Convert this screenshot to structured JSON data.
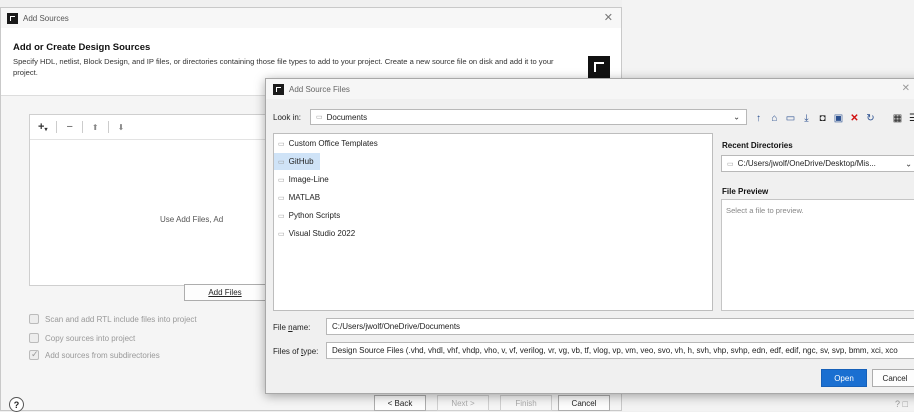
{
  "add_sources": {
    "title": "Add Sources",
    "heading": "Add or Create Design Sources",
    "description": "Specify HDL, netlist, Block Design, and IP files, or directories containing those file types to add to your project. Create a new source file on disk and add it to your project.",
    "panel_hint": "Use Add Files, Ad",
    "add_files_label": "Add Files",
    "options": [
      {
        "label": "Scan and add RTL include files into project",
        "checked": false
      },
      {
        "label": "Copy sources into project",
        "checked": false
      },
      {
        "label": "Add sources from subdirectories",
        "checked": true
      }
    ],
    "buttons": {
      "back": "< Back",
      "next": "Next >",
      "finish": "Finish",
      "cancel": "Cancel"
    },
    "help": "?"
  },
  "file_dialog": {
    "title": "Add Source Files",
    "look_in_label": "Look in:",
    "look_in_value": "Documents",
    "folders": [
      "Custom Office Templates",
      "GitHub",
      "Image-Line",
      "MATLAB",
      "Python Scripts",
      "Visual Studio 2022"
    ],
    "selected_folder": "GitHub",
    "recent_directories_label": "Recent Directories",
    "recent_directory_value": "C:/Users/jwolf/OneDrive/Desktop/Mis...",
    "file_preview_label": "File Preview",
    "file_preview_placeholder": "Select a file to preview.",
    "file_name_label": "File name:",
    "file_name_value": "C:/Users/jwolf/OneDrive/Documents",
    "files_of_type_label": "Files of type:",
    "files_of_type_value": "Design Source Files (.vhd, vhdl, vhf, vhdp, vho, v, vf, verilog, vr, vg, vb, tf, vlog, vp, vm, veo, svo, vh, h, svh, vhp, svhp, edn, edf, edif, ngc, sv, svp, bmm, xci, xco",
    "open_label": "Open",
    "cancel_label": "Cancel"
  },
  "colors": {
    "accent": "#1a6fd1",
    "selection": "#cfe3f7",
    "delete_icon": "#d01010"
  }
}
